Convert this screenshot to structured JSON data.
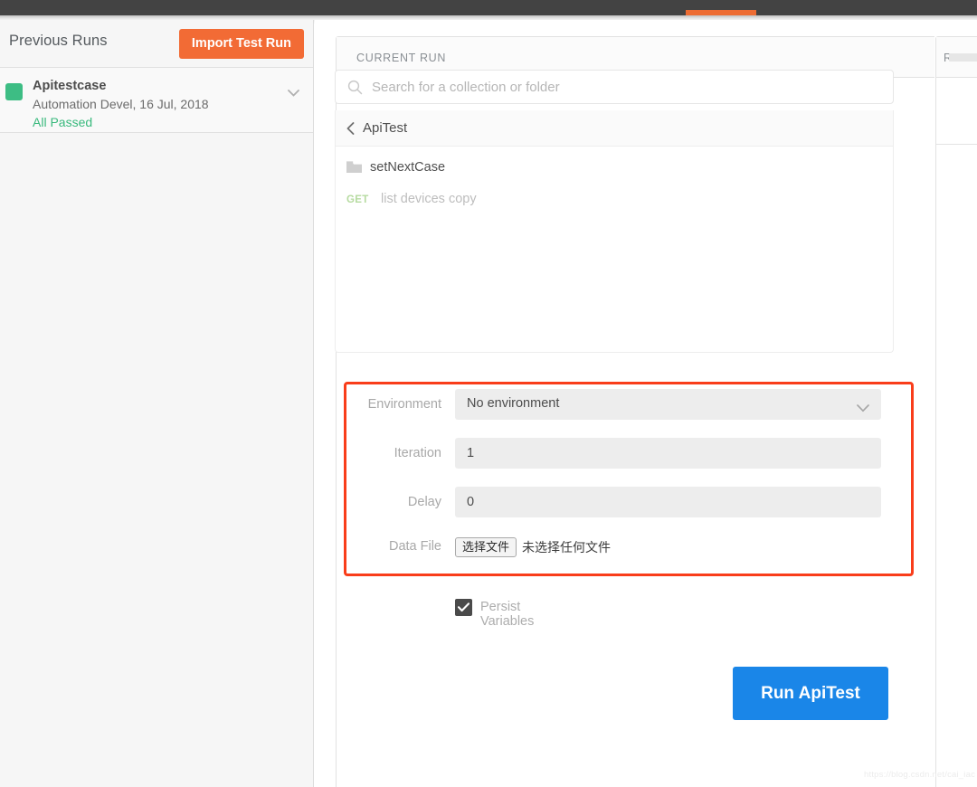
{
  "topbar": {
    "active_tab_indicator": true,
    "bar_color": "#434343",
    "indicator_color": "#ed6c33"
  },
  "sidebar": {
    "title": "Previous Runs",
    "import_button": "Import Test Run",
    "runs": [
      {
        "name": "Apitestcase",
        "meta": "Automation Devel, 16 Jul, 2018",
        "status": "All Passed",
        "status_color": "#39b97d",
        "square_color": "#3dbd84",
        "chevron": "chevron-down-icon"
      }
    ]
  },
  "main": {
    "card_title": "CURRENT RUN",
    "results_title": "RES",
    "search": {
      "placeholder": "Search for a collection or folder",
      "value": "",
      "icon": "search-icon"
    },
    "breadcrumb": {
      "back_icon": "chevron-left-icon",
      "label": "ApiTest"
    },
    "collection_items": [
      {
        "type": "folder",
        "icon": "folder-icon",
        "label": "setNextCase"
      },
      {
        "type": "request",
        "method": "GET",
        "label": "list devices copy"
      }
    ],
    "form": {
      "environment": {
        "label": "Environment",
        "value": "No environment",
        "chevron": "chevron-down-icon"
      },
      "iteration": {
        "label": "Iteration",
        "value": "1"
      },
      "delay": {
        "label": "Delay",
        "value": "0"
      },
      "data_file": {
        "label": "Data File",
        "button": "选择文件",
        "status": "未选择任何文件"
      }
    },
    "persist": {
      "label": "Persist Variables",
      "checked": true
    },
    "run_button": {
      "label": "Run ApiTest",
      "color": "#1a86e8"
    },
    "highlight": {
      "color": "#f93d1a",
      "target": "run-configuration-fields"
    }
  },
  "watermark": "https://blog.csdn.net/cai_iac"
}
